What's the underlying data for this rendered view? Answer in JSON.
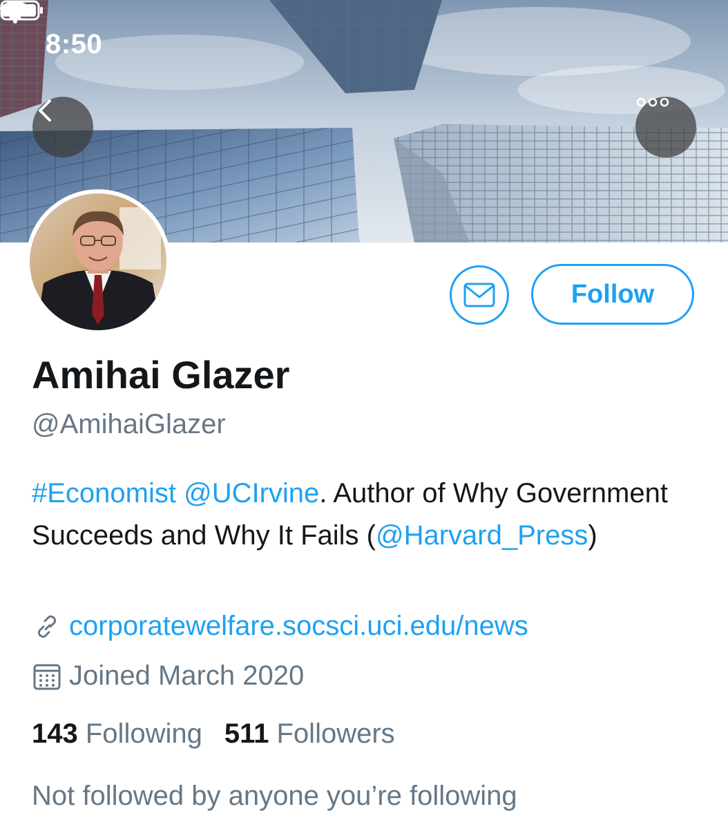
{
  "status_bar": {
    "time": "8:50",
    "icons": [
      "location-arrow-icon",
      "cellular-signal-icon",
      "wifi-icon",
      "battery-icon"
    ]
  },
  "header": {
    "back_icon": "chevron-left-icon",
    "more_icon": "ellipsis-icon"
  },
  "profile": {
    "display_name": "Amihai Glazer",
    "handle": "@AmihaiGlazer",
    "bio": {
      "hashtag": "#Economist",
      "mention_1": "@UCIrvine",
      "text_1": ". Author of Why Government Succeeds and Why It Fails (",
      "mention_2": "@Harvard_Press",
      "text_2": ")"
    },
    "website": "corporatewelfare.socsci.uci.edu/news",
    "joined": "Joined March 2020",
    "following_count": "143",
    "following_label": "Following",
    "followers_count": "511",
    "followers_label": "Followers",
    "followed_by_note": "Not followed by anyone you’re following"
  },
  "actions": {
    "message_icon": "envelope-icon",
    "follow_label": "Follow"
  },
  "colors": {
    "accent": "#1da1f2",
    "text_primary": "#14171a",
    "text_secondary": "#657786"
  }
}
